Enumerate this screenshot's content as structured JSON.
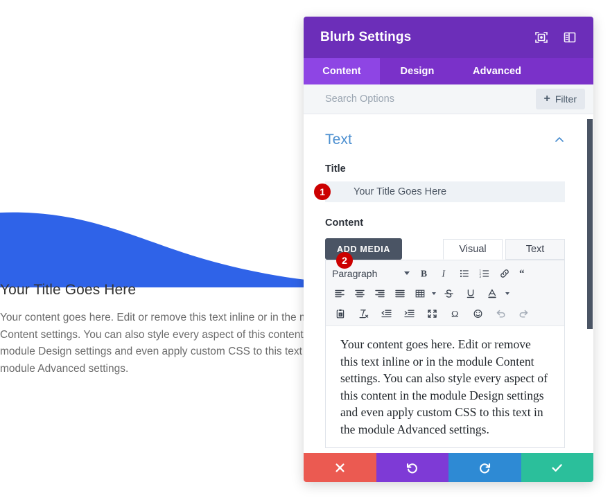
{
  "preview": {
    "title": "Your Title Goes Here",
    "paragraph": "Your content goes here. Edit or remove this text inline or in the module Content settings. You can also style every aspect of this content in the module Design settings and even apply custom CSS to this text in the module Advanced settings.",
    "wave_color": "#2f63e8"
  },
  "modal": {
    "title": "Blurb Settings",
    "header_color": "#6c2eb9",
    "icons": {
      "focus": "focus-target-icon",
      "layout": "panel-layout-icon"
    },
    "tabs": [
      {
        "label": "Content",
        "active": true
      },
      {
        "label": "Design",
        "active": false
      },
      {
        "label": "Advanced",
        "active": false
      }
    ],
    "search": {
      "value": "",
      "placeholder": "Search Options",
      "filter_label": "Filter",
      "filter_plus": "+"
    },
    "section": {
      "title": "Text",
      "collapse_icon": "chevron-up-icon"
    },
    "title_field": {
      "label": "Title",
      "value": "Your Title Goes Here",
      "badge": "1"
    },
    "content_field": {
      "label": "Content",
      "add_media_label": "ADD MEDIA",
      "editor_tabs": [
        {
          "label": "Visual",
          "active": true
        },
        {
          "label": "Text",
          "active": false
        }
      ],
      "badge": "2",
      "body": "Your content goes here. Edit or remove this text inline or in the module Content settings. You can also style every aspect of this content in the module Design settings and even apply custom CSS to this text in the module Advanced settings."
    },
    "toolbar": {
      "format_select": "Paragraph",
      "row1": [
        "bold-icon",
        "italic-icon",
        "bullet-list-icon",
        "numbered-list-icon",
        "link-icon",
        "blockquote-icon"
      ],
      "row2": [
        "align-left-icon",
        "align-center-icon",
        "align-right-icon",
        "align-justify-icon",
        "table-icon",
        "strikethrough-icon",
        "underline-icon",
        "text-color-icon"
      ],
      "row3": [
        "paste-as-text-icon",
        "clear-formatting-icon",
        "outdent-icon",
        "indent-icon",
        "fullscreen-icon",
        "special-character-icon",
        "emoji-icon",
        "undo-icon",
        "redo-icon"
      ]
    },
    "actions": [
      {
        "name": "cancel",
        "icon": "close-icon",
        "color": "#eb5a51"
      },
      {
        "name": "undo",
        "icon": "undo-icon",
        "color": "#7e3ad6"
      },
      {
        "name": "redo",
        "icon": "redo-icon",
        "color": "#2e8ad4"
      },
      {
        "name": "save",
        "icon": "check-icon",
        "color": "#2bbf9b"
      }
    ],
    "scrollbar": {
      "thumb_color": "#4a5464"
    }
  }
}
